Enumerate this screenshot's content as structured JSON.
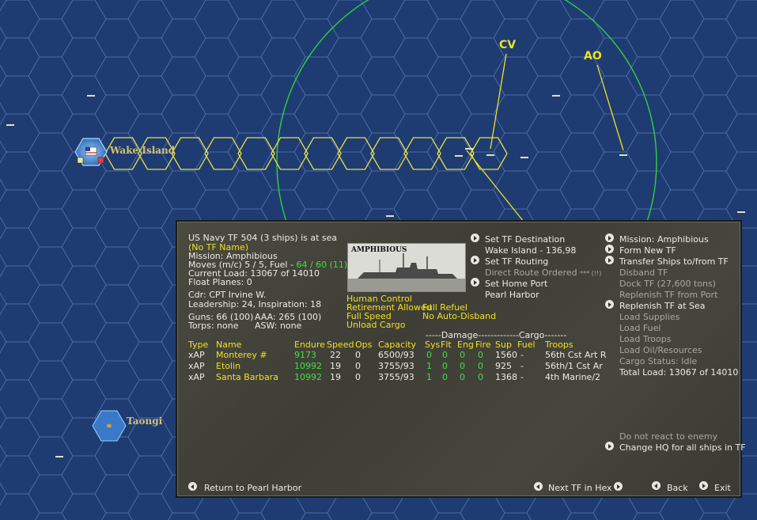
{
  "map": {
    "base_label": "Wake Island",
    "island_label": "Taongi",
    "markers": [
      "CV",
      "AO"
    ]
  },
  "tf": {
    "header": "US Navy TF 504 (3 ships) is at sea",
    "name": "(No TF Name)",
    "mission": "Mission:  Amphibious",
    "moves_prefix": "Moves (m/c)  5 / 5, Fuel - ",
    "moves_fuel": "64 / 60 (11)",
    "current_load": "Current Load:  13067 of 14010",
    "float_planes": "Float Planes:  0",
    "cdr": "Cdr: CPT  Irvine W.",
    "leadership": "Leadership: 24, Inspiration: 18",
    "guns": "Guns: 66 (100)",
    "aaa": "AAA: 265 (100)",
    "torps": "Torps: none",
    "asw": "ASW: none",
    "photo_label": "AMPHIBIOUS"
  },
  "options": {
    "human_control": "Human Control",
    "retirement": "Retirement Allowed",
    "full_refuel": "Full Refuel",
    "full_speed": "Full Speed",
    "no_auto_disband": "No Auto-Disband",
    "unload_cargo": "Unload Cargo"
  },
  "middle_menu": {
    "set_dest": "Set TF Destination",
    "dest_value": "Wake Island - 136,98",
    "set_routing": "Set TF Routing",
    "direct_route": "Direct Route Ordered",
    "direct_route_suffix": "*** (!!)",
    "set_home": "Set Home Port",
    "home_value": "Pearl Harbor"
  },
  "right_menu": {
    "mission": "Mission: Amphibious",
    "form_new": "Form New TF",
    "transfer": "Transfer Ships to/from TF",
    "disband": "Disband TF",
    "dock": "Dock TF (27,600 tons)",
    "replenish_port": "Replenish TF from Port",
    "replenish_sea": "Replenish TF at Sea",
    "load_supplies": "Load Supplies",
    "load_fuel": "Load Fuel",
    "load_troops": "Load Troops",
    "load_oil": "Load Oil/Resources",
    "cargo_status": "Cargo Status: Idle",
    "total_load": "Total Load: 13067 of 14010",
    "no_react": "Do not react to enemy",
    "change_hq": "Change HQ for all ships in TF"
  },
  "table": {
    "group_header": "-----Damage-------------Cargo-------",
    "columns": [
      "Type",
      "Name",
      "Endure",
      "Speed",
      "Ops",
      "Capacity",
      "Sys",
      "Flt",
      "Eng",
      "Fire",
      "Sup",
      "Fuel",
      "Troops"
    ],
    "rows": [
      [
        "xAP",
        "Monterey #",
        "9173",
        "22",
        "0",
        "6500/93",
        "0",
        "0",
        "0",
        "0",
        "1560",
        "-",
        "56th Cst Art R"
      ],
      [
        "xAP",
        "Etolin",
        "10992",
        "19",
        "0",
        "3755/93",
        "1",
        "0",
        "0",
        "0",
        "925",
        "-",
        "56th/1 Cst Ar"
      ],
      [
        "xAP",
        "Santa Barbara",
        "10992",
        "19",
        "0",
        "3755/93",
        "1",
        "0",
        "0",
        "0",
        "1368",
        "-",
        "4th Marine/2"
      ]
    ]
  },
  "footer": {
    "return": "Return to Pearl Harbor",
    "next_tf": "Next TF in Hex",
    "back": "Back",
    "exit": "Exit"
  }
}
